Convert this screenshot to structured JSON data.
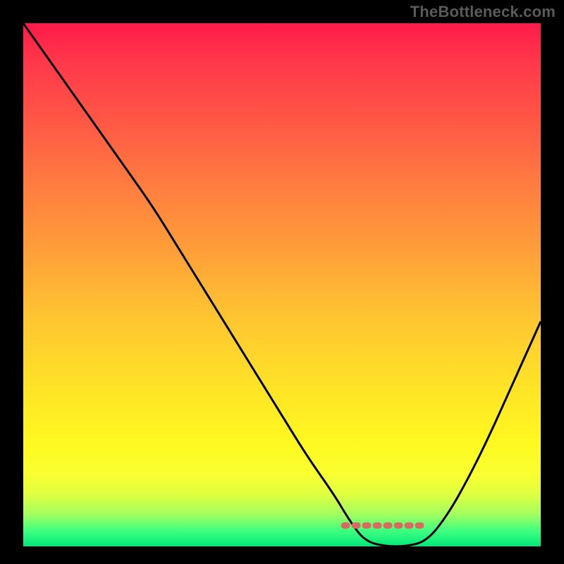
{
  "watermark": "TheBottleneck.com",
  "chart_data": {
    "type": "line",
    "title": "",
    "xlabel": "",
    "ylabel": "",
    "xlim": [
      0,
      100
    ],
    "ylim": [
      0,
      100
    ],
    "background_gradient": {
      "top": "#ff1a4a",
      "bottom": "#00e878",
      "description": "vertical gradient red through orange, yellow, to green"
    },
    "series": [
      {
        "name": "bottleneck-curve",
        "x": [
          0,
          5,
          10,
          15,
          20,
          25,
          30,
          35,
          40,
          45,
          50,
          55,
          60,
          63,
          66,
          70,
          74,
          78,
          82,
          86,
          90,
          95,
          100
        ],
        "values": [
          100,
          93,
          86,
          79,
          72,
          65,
          57,
          49,
          41,
          33,
          25,
          17,
          10,
          5,
          1,
          0,
          0,
          1,
          6,
          13,
          21,
          32,
          43
        ]
      }
    ],
    "annotations": [
      {
        "name": "optimal-flat-region",
        "type": "dashed-segment",
        "color": "#d86a60",
        "x_start": 62,
        "x_end": 78,
        "y": 4
      }
    ]
  }
}
